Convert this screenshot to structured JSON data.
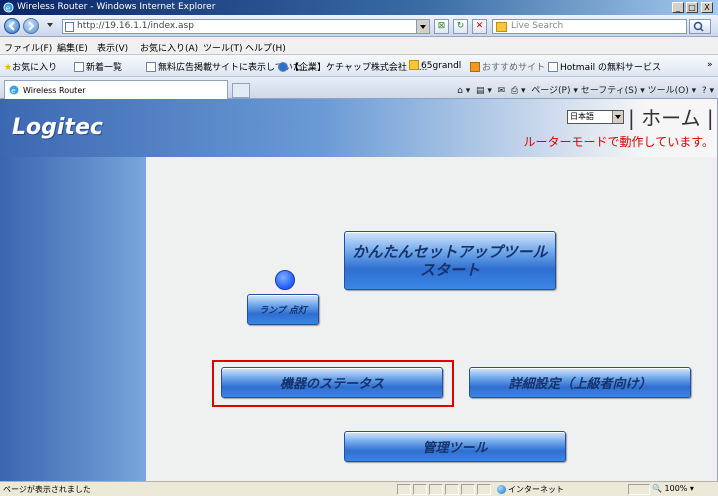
{
  "window": {
    "title": "Wireless Router - Windows Internet Explorer",
    "controls": {
      "minimize": "_",
      "maximize": "□",
      "close": "X"
    }
  },
  "address_bar": {
    "url": "http://19.16.1.1/index.asp",
    "search_placeholder": "Live Search"
  },
  "menu": {
    "items": [
      "ファイル(F)",
      "編集(E)",
      "表示(V)",
      "お気に入り(A)",
      "ツール(T)",
      "ヘルプ(H)"
    ]
  },
  "favorites_bar": {
    "favorites_label": "お気に入り",
    "items": [
      "お気に入り",
      "新着一覧",
      "無料広告掲載サイトに表示していた...",
      "【企業】ケチャップ株式会社 バ...",
      "65grandl",
      "おすすめサイト",
      "Hotmail の無料サービス"
    ]
  },
  "tabs": {
    "active_title": "Wireless Router"
  },
  "command_bar": {
    "text": "ページ(P) ▾ セーフティ(S) ▾ ツール(O) ▾"
  },
  "page": {
    "logo": "Logitec",
    "language_select": "日本語",
    "home_title": "| ホーム |",
    "router_mode_text": "ルーターモードで動作しています。",
    "buttons": {
      "easy_setup_line1": "かんたんセットアップツール",
      "easy_setup_line2": "スタート",
      "lamp": "ランプ 点灯",
      "device_status": "機器のステータス",
      "advanced_settings": "詳細設定（上級者向け）",
      "admin_tools": "管理ツール"
    }
  },
  "status_bar": {
    "message": "ページが表示されました",
    "zone": "インターネット",
    "zoom": "100%"
  },
  "colors": {
    "accent_blue": "#2f6fd1",
    "highlight_red": "#e00000",
    "router_mode_red": "#e10000"
  }
}
